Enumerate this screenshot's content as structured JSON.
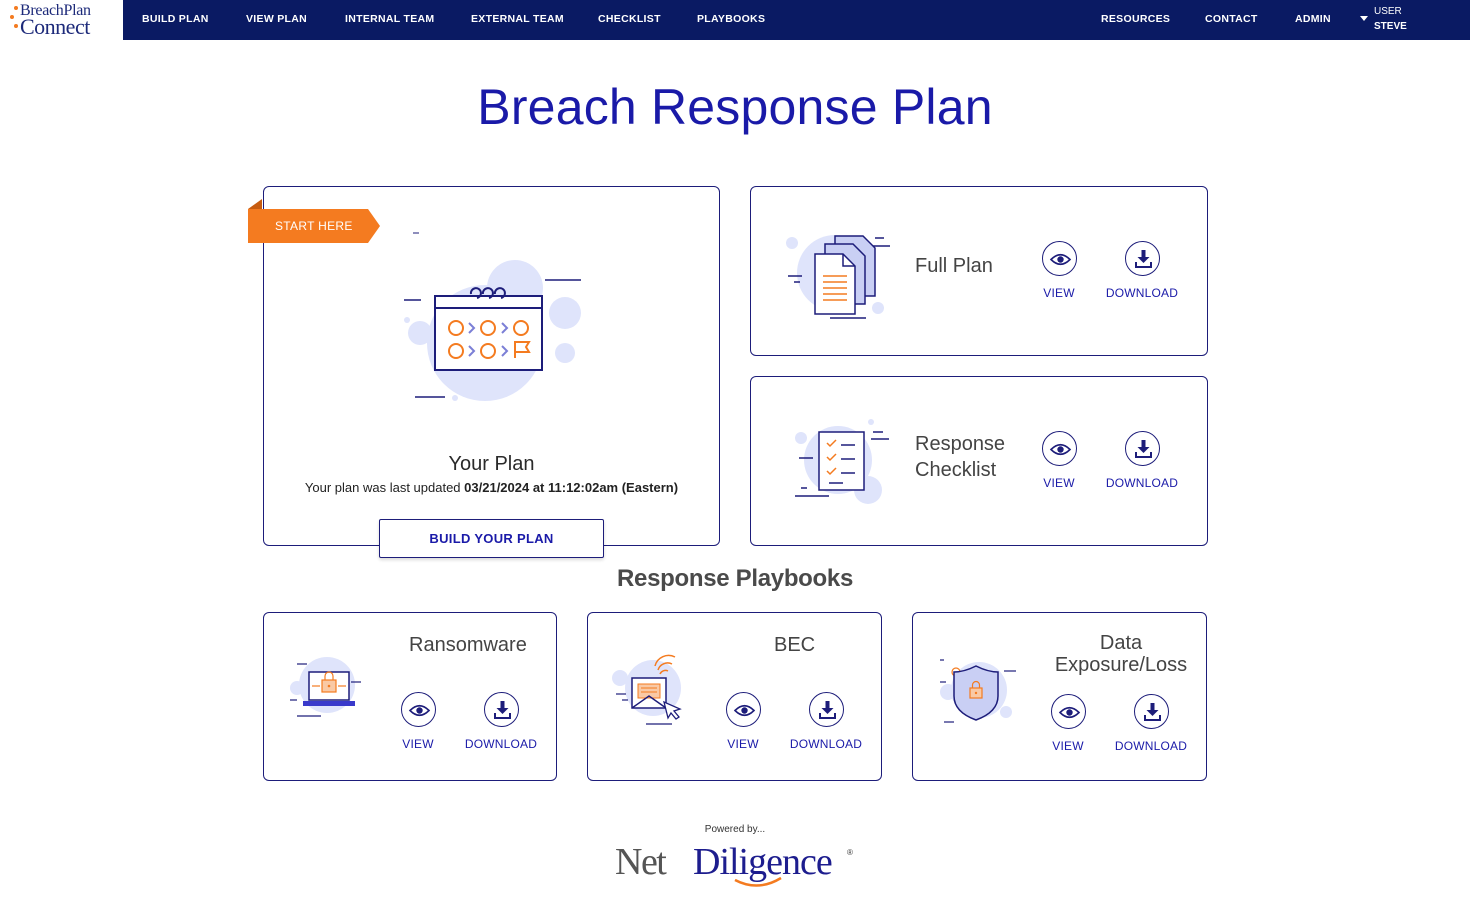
{
  "brand": {
    "logo_top": "BreachPlan",
    "logo_bottom": "Connect"
  },
  "nav": {
    "left": [
      "BUILD PLAN",
      "VIEW PLAN",
      "INTERNAL TEAM",
      "EXTERNAL TEAM",
      "CHECKLIST",
      "PLAYBOOKS"
    ],
    "right": [
      "RESOURCES",
      "CONTACT",
      "ADMIN"
    ],
    "user_label": "USER",
    "user_name": "STEVE"
  },
  "page_title": "Breach Response Plan",
  "your_plan": {
    "ribbon": "START HERE",
    "title": "Your Plan",
    "updated_prefix": "Your plan was last updated ",
    "updated_value": "03/21/2024 at 11:12:02am (Eastern)",
    "button": "BUILD YOUR PLAN"
  },
  "plan_cards": [
    {
      "title": "Full Plan",
      "view": "VIEW",
      "download": "DOWNLOAD"
    },
    {
      "title_line1": "Response",
      "title_line2": "Checklist",
      "view": "VIEW",
      "download": "DOWNLOAD"
    }
  ],
  "playbooks_title": "Response Playbooks",
  "playbooks": [
    {
      "title": "Ransomware",
      "view": "VIEW",
      "download": "DOWNLOAD"
    },
    {
      "title": "BEC",
      "view": "VIEW",
      "download": "DOWNLOAD"
    },
    {
      "title_line1": "Data",
      "title_line2": "Exposure/Loss",
      "view": "VIEW",
      "download": "DOWNLOAD"
    }
  ],
  "footer": {
    "powered_by": "Powered by...",
    "logo_net": "Net",
    "logo_diligence": "Diligence",
    "logo_reg": "®"
  },
  "colors": {
    "nav_bg": "#0a1a63",
    "accent_orange": "#f47b20",
    "primary_blue": "#1a1aa8",
    "blob_blue": "#dfe4fb"
  },
  "icons": [
    "calendar-process-icon",
    "documents-icon",
    "checklist-icon",
    "laptop-lock-icon",
    "envelope-signal-icon",
    "shield-lock-icon",
    "eye-icon",
    "download-icon",
    "caret-down-icon"
  ]
}
